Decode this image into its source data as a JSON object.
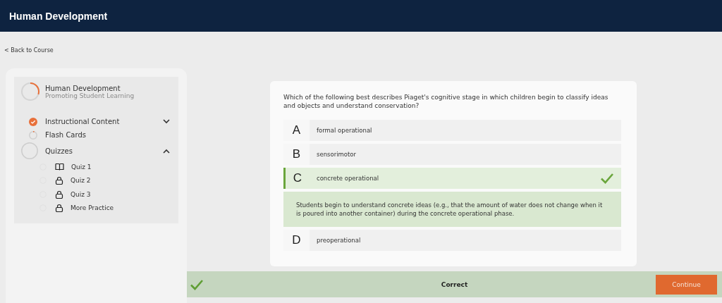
{
  "header": {
    "title": "Human Development"
  },
  "back_link": "< Back to Course",
  "sidebar": {
    "course": {
      "title": "Human Development",
      "subtitle": "Promoting Student Learning"
    },
    "sections": [
      {
        "label": "Instructional Content",
        "kind": "complete",
        "expanded": false
      },
      {
        "label": "Flash Cards",
        "kind": "progress"
      },
      {
        "label": "Quizzes",
        "kind": "group",
        "expanded": true,
        "children": [
          {
            "label": "Quiz 1",
            "locked": false
          },
          {
            "label": "Quiz 2",
            "locked": true
          },
          {
            "label": "Quiz 3",
            "locked": true
          },
          {
            "label": "More Practice",
            "locked": true
          }
        ]
      }
    ]
  },
  "question": {
    "text": "Which of the following best describes Piaget's cognitive stage in which children begin to classify ideas and objects and understand conservation?",
    "options": [
      {
        "letter": "A",
        "text": "formal operational",
        "selected": false
      },
      {
        "letter": "B",
        "text": "sensorimotor",
        "selected": false
      },
      {
        "letter": "C",
        "text": "concrete operational",
        "selected": true,
        "explanation": "Students begin to understand concrete ideas (e.g., that the amount of water does not change when it is poured into another container) during the concrete operational phase."
      },
      {
        "letter": "D",
        "text": "preoperational",
        "selected": false
      }
    ]
  },
  "feedback": {
    "correct": true,
    "text": "Correct",
    "button": "Continue"
  }
}
